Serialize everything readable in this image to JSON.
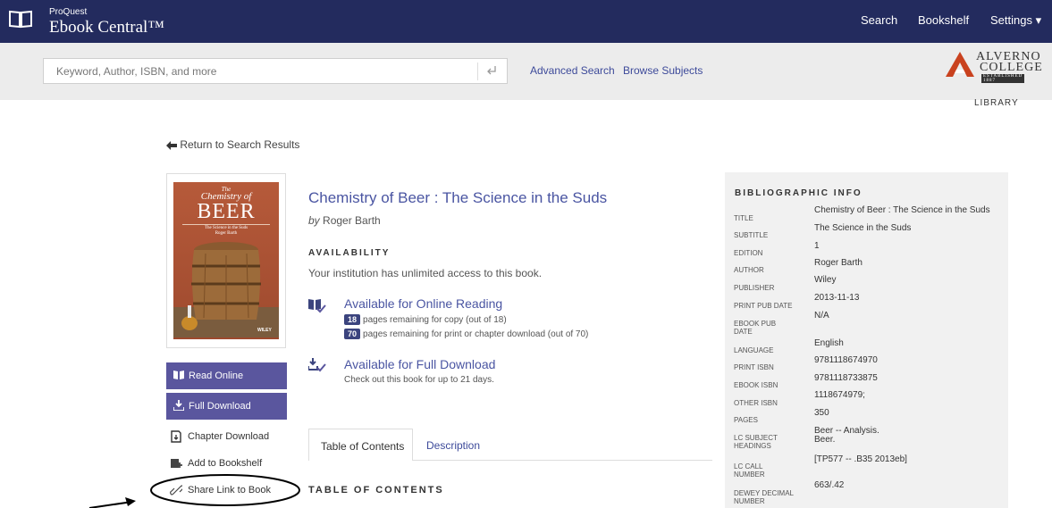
{
  "header": {
    "brand_top": "ProQuest",
    "brand_main": "Ebook Central™",
    "nav": {
      "search": "Search",
      "bookshelf": "Bookshelf",
      "settings": "Settings ▾"
    }
  },
  "searchbar": {
    "placeholder": "Keyword, Author, ISBN, and more",
    "advanced": "Advanced Search",
    "browse": "Browse Subjects"
  },
  "institution": {
    "line1": "ALVERNO",
    "line2": "COLLEGE",
    "est": "ESTABLISHED 1887",
    "library": "LIBRARY",
    "accent": "#c9421f"
  },
  "return_link": "Return to Search Results",
  "cover": {
    "the": "The",
    "chemistry": "Chemistry of",
    "beer": "BEER",
    "subtitle": "The Science in the Suds",
    "author": "Roger Barth",
    "publisher": "WILEY"
  },
  "actions": {
    "read_online": "Read Online",
    "full_download": "Full Download",
    "chapter_download": "Chapter Download",
    "add_to_bookshelf": "Add to Bookshelf",
    "share_link": "Share Link to Book"
  },
  "book": {
    "title": "Chemistry of Beer : The Science in the Suds",
    "by": "by",
    "author": "Roger Barth"
  },
  "availability": {
    "heading": "AVAILABILITY",
    "text": "Your institution has unlimited access to this book.",
    "online": {
      "title": "Available for Online Reading",
      "copy_count": "18",
      "copy_text": "pages remaining for copy (out of 18)",
      "print_count": "70",
      "print_text": "pages remaining for print or chapter download (out of 70)"
    },
    "download": {
      "title": "Available for Full Download",
      "text": "Check out this book for up to 21 days."
    }
  },
  "tabs": {
    "toc": "Table of Contents",
    "description": "Description"
  },
  "toc_heading": "TABLE OF CONTENTS",
  "biblio": {
    "heading": "BIBLIOGRAPHIC INFO",
    "title_label": "TITLE",
    "title_value": "Chemistry of Beer : The Science in the Suds",
    "subtitle_label": "SUBTITLE",
    "subtitle_value": "The Science in the Suds",
    "edition_label": "EDITION",
    "edition_value": "1",
    "author_label": "AUTHOR",
    "author_value": "Roger Barth",
    "publisher_label": "PUBLISHER",
    "publisher_value": "Wiley",
    "printpub_label": "PRINT PUB DATE",
    "printpub_value": "2013-11-13",
    "ebookpub_label1": "EBOOK PUB",
    "ebookpub_label2": "DATE",
    "ebookpub_value": "N/A",
    "language_label": "LANGUAGE",
    "language_value": "English",
    "printisbn_label": "PRINT ISBN",
    "printisbn_value": "9781118674970",
    "ebookisbn_label": "EBOOK ISBN",
    "ebookisbn_value": "9781118733875",
    "otherisbn_label": "OTHER ISBN",
    "otherisbn_value": "1118674979;",
    "pages_label": "PAGES",
    "pages_value": "350",
    "lcsubject_label1": "LC SUBJECT",
    "lcsubject_label2": "HEADINGS",
    "lcsubject_value1": "Beer -- Analysis.",
    "lcsubject_value2": "Beer.",
    "lccall_label1": "LC CALL",
    "lccall_label2": "NUMBER",
    "lccall_value": "[TP577 -- .B35 2013eb]",
    "dewey_label1": "DEWEY DECIMAL",
    "dewey_label2": "NUMBER",
    "dewey_value": "663/.42"
  },
  "colors": {
    "topbar": "#232b5e",
    "button": "#5a569e",
    "link": "#4a55a2"
  }
}
